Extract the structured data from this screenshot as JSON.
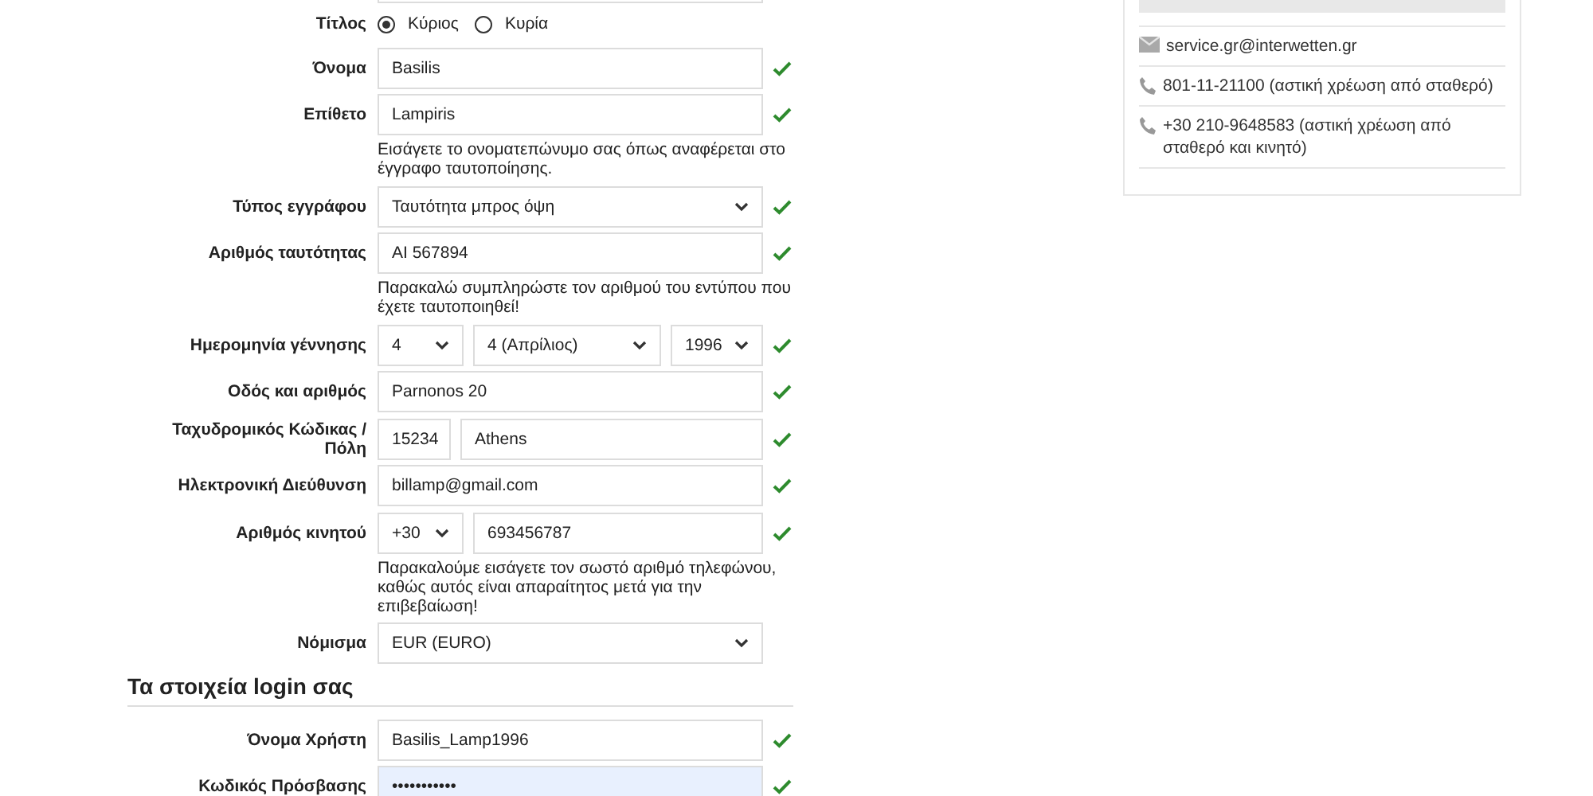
{
  "form": {
    "rows": [
      {
        "kind": "partial"
      },
      {
        "kind": "radio",
        "label": "Τίτλος",
        "options": [
          {
            "label": "Κύριος",
            "selected": true
          },
          {
            "label": "Κυρία",
            "selected": false
          }
        ]
      },
      {
        "kind": "text",
        "label": "Όνομα",
        "value": "Basilis",
        "valid": true
      },
      {
        "kind": "text",
        "label": "Επίθετο",
        "value": "Lampiris",
        "valid": true,
        "hint": "Εισάγετε το ονοματεπώνυμο σας όπως αναφέρεται στο έγγραφο ταυτοποίησης."
      },
      {
        "kind": "select",
        "label": "Τύπος εγγράφου",
        "value": "Ταυτότητα μπρος όψη",
        "valid": true
      },
      {
        "kind": "text",
        "label": "Αριθμός ταυτότητας",
        "value": "AI 567894",
        "valid": true,
        "hint": "Παρακαλώ συμπληρώστε τον αριθμού του εντύπου που έχετε ταυτοποιηθεί!"
      },
      {
        "kind": "date",
        "label": "Ημερομηνία γέννησης",
        "day": "4",
        "month": "4 (Απρίλιος)",
        "year": "1996",
        "valid": true
      },
      {
        "kind": "text",
        "label": "Οδός και αριθμός",
        "value": "Parnonos 20",
        "valid": true
      },
      {
        "kind": "postal",
        "label": "Ταχυδρομικός Κώδικας / Πόλη",
        "zip": "15234",
        "city": "Athens",
        "valid": true
      },
      {
        "kind": "text",
        "label": "Ηλεκτρονική Διεύθυνση",
        "value": "billamp@gmail.com",
        "valid": true
      },
      {
        "kind": "phone",
        "label": "Αριθμός κινητού",
        "code": "+30",
        "value": "693456787",
        "valid": true,
        "hint": "Παρακαλούμε εισάγετε τον σωστό αριθμό τηλεφώνου, καθώς αυτός είναι απαραίτητος μετά για την επιβεβαίωση!"
      },
      {
        "kind": "select",
        "label": "Νόμισμα",
        "value": "EUR (EURO)",
        "valid": false
      },
      {
        "kind": "heading",
        "label": "Τα στοιχεία login σας"
      },
      {
        "kind": "text",
        "label": "Όνομα Χρήστη",
        "value": "Basilis_Lamp1996",
        "valid": true
      },
      {
        "kind": "password",
        "label": "Κωδικός Πρόσβασης",
        "value": "•••••••••••",
        "valid": true
      }
    ]
  },
  "contact": {
    "items": [
      {
        "kind": "email",
        "text": "service.gr@interwetten.gr"
      },
      {
        "kind": "phone",
        "text": "801-11-21100 (αστική χρέωση από σταθερό)"
      },
      {
        "kind": "phone",
        "text": "+30 210-9648583 (αστική χρέωση από σταθερό και κινητό)"
      }
    ]
  }
}
